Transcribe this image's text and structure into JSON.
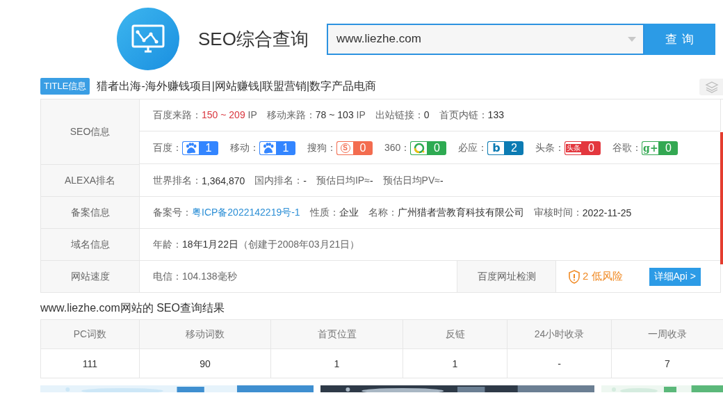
{
  "header": {
    "title": "SEO综合查询",
    "query": "www.liezhe.com",
    "button": "查 询"
  },
  "title_info": {
    "badge": "TITLE信息",
    "text": "猎者出海-海外赚钱项目|网站赚钱|联盟营销|数字产品电商"
  },
  "seo_info": {
    "label": "SEO信息",
    "traffic": [
      {
        "label": "百度来路：",
        "value": "150 ~ 209",
        "unit": "IP",
        "color": "#d9363e"
      },
      {
        "label": "移动来路：",
        "value": "78 ~ 103",
        "unit": "IP",
        "color": "#333333"
      },
      {
        "label": "出站链接：",
        "value": "0",
        "color": "#333333"
      },
      {
        "label": "首页内链：",
        "value": "133",
        "color": "#333333"
      }
    ],
    "engines": [
      {
        "label": "百度：",
        "value": "1",
        "kind": "baidu",
        "color": "#3385ff"
      },
      {
        "label": "移动：",
        "value": "1",
        "kind": "baidu_mobile",
        "color": "#3385ff"
      },
      {
        "label": "搜狗：",
        "value": "0",
        "kind": "sogou",
        "icon_text": "S",
        "color": "#f36c4f"
      },
      {
        "label": "360：",
        "value": "0",
        "kind": "so360",
        "color": "#2eaa52"
      },
      {
        "label": "必应：",
        "value": "2",
        "kind": "bing",
        "icon_text": "b",
        "color": "#0c7bb3"
      },
      {
        "label": "头条：",
        "value": "0",
        "kind": "toutiao",
        "icon_text": "头条",
        "color": "#e3373e"
      },
      {
        "label": "谷歌：",
        "value": "0",
        "kind": "google",
        "icon_text": "g+",
        "color": "#33a852"
      }
    ]
  },
  "info_rows": [
    {
      "label": "ALEXA排名",
      "fields": [
        {
          "label": "世界排名：",
          "value": "1,364,870"
        },
        {
          "label": "国内排名：",
          "value": "-"
        },
        {
          "label": "预估日均IP≈",
          "value": "-"
        },
        {
          "label": "预估日均PV≈",
          "value": "-"
        }
      ]
    },
    {
      "label": "备案信息",
      "fields": [
        {
          "label": "备案号：",
          "value": "粤ICP备2022142219号-1",
          "kind": "link"
        },
        {
          "label": "性质：",
          "value": "企业"
        },
        {
          "label": "名称：",
          "value": "广州猎者营教育科技有限公司"
        },
        {
          "label": "审核时间：",
          "value": "2022-11-25"
        }
      ]
    },
    {
      "label": "域名信息",
      "fields": [
        {
          "label": "年龄：",
          "value": "18年1月22日",
          "note": "（创建于2008年03月21日）"
        }
      ]
    }
  ],
  "speed": {
    "label": "网站速度",
    "value": "电信：104.138毫秒",
    "check_label": "百度网址检测",
    "risk": "2 低风险",
    "button": "详细Api >"
  },
  "results": {
    "title": "www.liezhe.com网站的 SEO查询结果",
    "columns": [
      "PC词数",
      "移动词数",
      "首页位置",
      "反链",
      "24小时收录",
      "一周收录"
    ],
    "values": [
      "111",
      "90",
      "1",
      "1",
      "-",
      "7"
    ]
  }
}
